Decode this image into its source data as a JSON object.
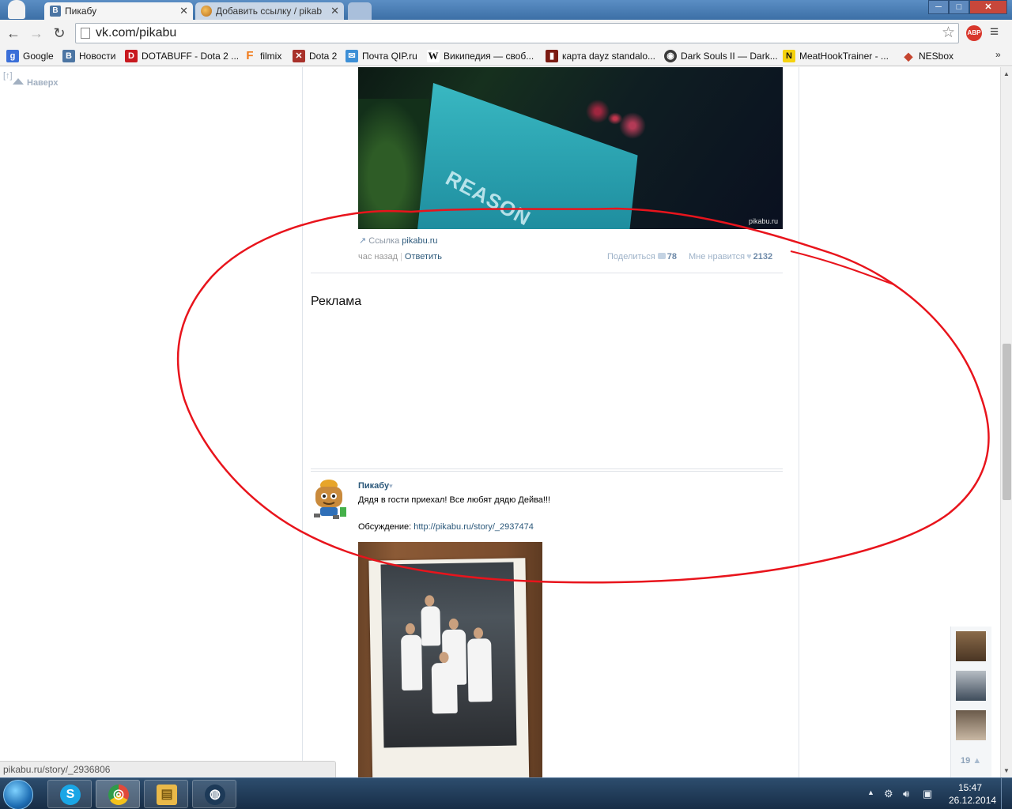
{
  "browser": {
    "tabs": [
      {
        "label": "Пикабу",
        "favicon": "vk-icon",
        "active": true
      },
      {
        "label": "Добавить ссылку / pikab",
        "favicon": "pikabu-icon",
        "active": false
      }
    ],
    "url": "vk.com/pikabu",
    "abp_label": "ABP",
    "window_controls": {
      "minimize": "─",
      "maximize": "□",
      "close": "✕"
    },
    "menu_glyph": "≡"
  },
  "bookmarks": [
    {
      "label": "Google",
      "icon": "google-icon",
      "color": "#3b6fd8",
      "glyph": "g"
    },
    {
      "label": "Новости",
      "icon": "vk-icon",
      "color": "#4c75a3",
      "glyph": "В"
    },
    {
      "label": "DOTABUFF - Dota 2 ...",
      "icon": "dotabuff-icon",
      "color": "#c8191f",
      "glyph": "D"
    },
    {
      "label": "filmix",
      "icon": "filmix-icon",
      "color": "#f07a18",
      "glyph": "F"
    },
    {
      "label": "Dota 2",
      "icon": "dota-icon",
      "color": "#a8312a",
      "glyph": "✕"
    },
    {
      "label": "Почта QIP.ru",
      "icon": "mail-icon",
      "color": "#3d8fd6",
      "glyph": "✉"
    },
    {
      "label": "Википедия — своб...",
      "icon": "wikipedia-icon",
      "color": "#ffffff",
      "glyph": "W"
    },
    {
      "label": "карта dayz standalo...",
      "icon": "dayz-icon",
      "color": "#7b1b12",
      "glyph": "▮"
    },
    {
      "label": "Dark Souls II — Dark...",
      "icon": "darksouls-icon",
      "color": "#3b3b3b",
      "glyph": "◉"
    },
    {
      "label": "MeatHookTrainer - ...",
      "icon": "meathook-icon",
      "color": "#f5d20f",
      "glyph": "N"
    },
    {
      "label": "NESbox",
      "icon": "nesbox-icon",
      "color": "#c5452f",
      "glyph": "◆"
    }
  ],
  "bookmarks_more": "»",
  "page": {
    "up_bracket": "[↑]",
    "up_label": "Наверх",
    "post1": {
      "image_text": "REASON",
      "watermark": "pikabu.ru",
      "source_prefix": "Ссылка",
      "source_link": "pikabu.ru",
      "time": "час назад",
      "reply": "Ответить",
      "share_label": "Поделиться",
      "share_count": "78",
      "like_label": "Мне нравится",
      "like_count": "2132"
    },
    "ad_heading": "Реклама",
    "post2": {
      "author": "Пикабу",
      "author_caret": "▾",
      "text": "Дядя в гости приехал! Все любят дядю Дейва!!!",
      "discuss_label": "Обсуждение:",
      "discuss_link": "http://pikabu.ru/story/_2937474"
    },
    "status_url": "pikabu.ru/story/_2936806",
    "online_count": "19"
  },
  "annotation": {
    "color": "#e8141c"
  },
  "taskbar": {
    "apps": [
      {
        "name": "skype",
        "glyph": "S",
        "color": "#1aa6e6"
      },
      {
        "name": "chrome",
        "glyph": "◎",
        "color": "#e04a3a"
      },
      {
        "name": "explorer",
        "glyph": "▤",
        "color": "#e9b949"
      },
      {
        "name": "steam",
        "glyph": "◍",
        "color": "#1d3a58"
      }
    ],
    "time": "15:47",
    "date": "26.12.2014",
    "tray_up": "▲"
  }
}
